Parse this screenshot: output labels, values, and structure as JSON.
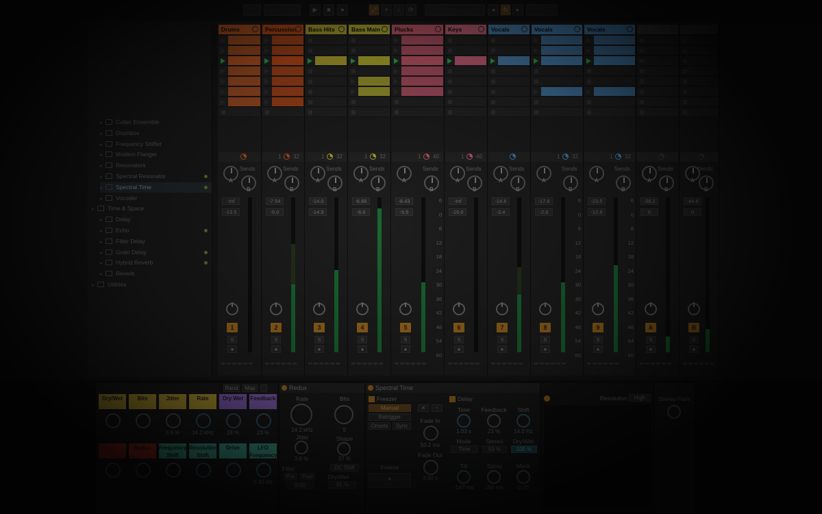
{
  "toolbar": {
    "left_fields": [
      "",
      "",
      ""
    ],
    "right_fields": [
      "",
      "",
      ""
    ]
  },
  "browser": {
    "items": [
      {
        "label": "",
        "indent": 1,
        "folder": false
      },
      {
        "label": "",
        "indent": 1,
        "folder": false
      },
      {
        "label": "",
        "indent": 1,
        "folder": false
      },
      {
        "label": "",
        "indent": 1,
        "folder": false
      },
      {
        "label": "",
        "indent": 1,
        "folder": false
      },
      {
        "label": "Cutter Ensemble",
        "indent": 1,
        "folder": true
      },
      {
        "label": "Drumbox",
        "indent": 1,
        "folder": true
      },
      {
        "label": "Frequency Shifter",
        "indent": 1,
        "folder": true
      },
      {
        "label": "Modern Flanger",
        "indent": 1,
        "folder": true
      },
      {
        "label": "Resonators",
        "indent": 1,
        "folder": true
      },
      {
        "label": "Spectral Resonator",
        "indent": 1,
        "folder": true,
        "dot": true
      },
      {
        "label": "Spectral Time",
        "indent": 1,
        "folder": true,
        "dot": true,
        "selected": true
      },
      {
        "label": "Vocoder",
        "indent": 1,
        "folder": true
      },
      {
        "label": "Time & Space",
        "indent": 0,
        "folder": true
      },
      {
        "label": "Delay",
        "indent": 1,
        "folder": true
      },
      {
        "label": "Echo",
        "indent": 1,
        "folder": true,
        "dot": true
      },
      {
        "label": "Filter Delay",
        "indent": 1,
        "folder": true
      },
      {
        "label": "Grain Delay",
        "indent": 1,
        "folder": true,
        "dot": true
      },
      {
        "label": "Hybrid Reverb",
        "indent": 1,
        "folder": true,
        "dot": true
      },
      {
        "label": "Reverb",
        "indent": 1,
        "folder": true
      },
      {
        "label": "Utilities",
        "indent": 0,
        "folder": true
      }
    ]
  },
  "tracks": [
    {
      "name": "Drums",
      "color": "#e4682a",
      "clips": [
        1,
        1,
        1,
        1,
        1,
        1,
        1
      ],
      "playing": 2,
      "n1": "",
      "n2": "",
      "vol": "-Inf",
      "peak": "-13.5",
      "num": "1",
      "level": 0.0,
      "ghost": 0.0
    },
    {
      "name": "Percussion",
      "color": "#e65a1c",
      "clips": [
        1,
        1,
        1,
        1,
        1,
        1,
        1
      ],
      "playing": 2,
      "n1": "1",
      "n2": "32",
      "vol": "-7.54",
      "peak": "-6.0",
      "num": "2",
      "level": 0.44,
      "ghost": 0.7
    },
    {
      "name": "Bass Hits",
      "color": "#d7c83a",
      "clips": [
        0,
        0,
        1,
        0,
        0,
        0,
        0
      ],
      "playing": 2,
      "n1": "1",
      "n2": "32",
      "vol": "-14.0",
      "peak": "-14.9",
      "num": "3",
      "level": 0.53,
      "ghost": 0.0
    },
    {
      "name": "Bass Main",
      "color": "#dbd43c",
      "clips": [
        0,
        0,
        1,
        0,
        1,
        1,
        0
      ],
      "playing": 2,
      "n1": "1",
      "n2": "32",
      "vol": "-6.66",
      "peak": "-6.0",
      "num": "4",
      "level": 0.93,
      "ghost": 0.0
    },
    {
      "name": "Plucks",
      "color": "#ee6a82",
      "clips": [
        1,
        1,
        1,
        1,
        1,
        1,
        0
      ],
      "playing": 2,
      "n1": "1",
      "n2": "40",
      "vol": "-8.43",
      "peak": "-5.5",
      "num": "5",
      "level": 0.45,
      "ghost": 0.0
    },
    {
      "name": "Keys",
      "color": "#ef7592",
      "clips": [
        0,
        0,
        1,
        0,
        0,
        0,
        0
      ],
      "playing": 2,
      "n1": "1",
      "n2": "40",
      "vol": "-Inf",
      "peak": "-16.0",
      "num": "6",
      "level": 0.0,
      "ghost": 0.0
    },
    {
      "name": "Vocals",
      "color": "#5a9fd8",
      "clips": [
        0,
        0,
        1,
        0,
        0,
        0,
        0
      ],
      "playing": 2,
      "n1": "",
      "n2": "",
      "vol": "-14.6",
      "peak": "-3.4",
      "num": "7",
      "level": 0.37,
      "ghost": 0.55
    },
    {
      "name": "Vocals",
      "color": "#5aa6e6",
      "clips": [
        1,
        1,
        1,
        0,
        0,
        1,
        0
      ],
      "playing": 2,
      "n1": "1",
      "n2": "32",
      "vol": "-17.8",
      "peak": "-2.6",
      "num": "8",
      "level": 0.45,
      "ghost": 0.0
    },
    {
      "name": "Vocals",
      "color": "#56a2e2",
      "clips": [
        1,
        1,
        1,
        0,
        0,
        1,
        0
      ],
      "playing": 2,
      "n1": "1",
      "n2": "32",
      "vol": "-23.5",
      "peak": "-12.8",
      "num": "9",
      "level": 0.56,
      "ghost": 0.0
    },
    {
      "name": "",
      "color": "#4a4a4a",
      "clips": [
        0,
        0,
        0,
        0,
        0,
        0,
        0
      ],
      "playing": -1,
      "n1": "",
      "n2": "",
      "vol": "-38.2",
      "peak": "0",
      "num": "A",
      "level": 0.1,
      "ghost": 0.0
    },
    {
      "name": "",
      "color": "#4a4a4a",
      "clips": [
        0,
        0,
        0,
        0,
        0,
        0,
        0
      ],
      "playing": -1,
      "n1": "",
      "n2": "",
      "vol": "-44.8",
      "peak": "0",
      "num": "B",
      "level": 0.15,
      "ghost": 0.0
    }
  ],
  "mixer": {
    "sends_label": "Sends",
    "knob_a": "A",
    "knob_b": "B",
    "solo": "S",
    "scale": [
      "6",
      "0",
      "6",
      "12",
      "18",
      "24",
      "30",
      "36",
      "42",
      "48",
      "54",
      "60"
    ]
  },
  "macros": {
    "topbtns": [
      "Rand",
      "Map"
    ],
    "row1": [
      {
        "label": "Dry/Wet",
        "color": "#d7b93a",
        "value": ""
      },
      {
        "label": "Bits",
        "color": "#d7b93a",
        "value": ""
      },
      {
        "label": "Jitter",
        "color": "#d7b93a",
        "value": "3.6 %"
      },
      {
        "label": "Rate",
        "color": "#d7b93a",
        "value": "14.2 kHz"
      },
      {
        "label": "Dry Wet",
        "color": "#9a6fd6",
        "value": "28 %"
      },
      {
        "label": "Feedback",
        "color": "#9a6fd6",
        "value": "23 %"
      }
    ],
    "row2": [
      {
        "label": "",
        "color": "#d23a2a",
        "value": ""
      },
      {
        "label": "Redux",
        "color": "#d23a2a",
        "value": ""
      },
      {
        "label": "Frequency Shift",
        "color": "#4bc5a8",
        "value": ""
      },
      {
        "label": "Resolution Shift",
        "color": "#4bc5a8",
        "value": ""
      },
      {
        "label": "Drive",
        "color": "#4bc5a8",
        "value": ""
      },
      {
        "label": "LFO Frequency",
        "color": "#4bc5a8",
        "value": "0.30 Hz"
      }
    ]
  },
  "redux": {
    "title": "Redux",
    "rate_label": "Rate",
    "rate_value": "14.2 kHz",
    "bits_label": "Bits",
    "bits_value": "5",
    "jitter_label": "Jitter",
    "jitter_value": "3.6 %",
    "shape_label": "Shape",
    "shape_value": "37 %",
    "dc_shift": "DC Shift",
    "filter_label": "Filter",
    "pre": "Pre",
    "post": "Post",
    "drywet_label": "Dry/Wet",
    "drywet_value": "81 %",
    "filter_value": "0.00"
  },
  "spectral": {
    "title": "Spectral Time",
    "freezer_label": "Freezer",
    "manual": "Manual",
    "retrigger": "Retrigger",
    "onsets": "Onsets",
    "sync": "Sync",
    "fade_in_label": "Fade In",
    "fade_in_value": "50.2 ms",
    "fade_out_label": "Fade Out",
    "fade_out_value": "3.90 s",
    "freeze_label": "Freeze",
    "freeze_symbol": "*",
    "delay_label": "Delay",
    "time_label": "Time",
    "time_value": "1.03 s",
    "feedback_label": "Feedback",
    "feedback_value": "23 %",
    "shift_label": "Shift",
    "shift_value": "14.0 Hz",
    "mode_label": "Mode",
    "mode_value": "Time",
    "stereo_label": "Stereo",
    "stereo_value": "53 %",
    "drywet_label": "Dry/Wet",
    "drywet_value": "100 %",
    "tilt_label": "Tilt",
    "tilt_value": "-147 ms",
    "spray_label": "Spray",
    "spray_value": "160 ms",
    "mask_label": "Mask",
    "mask_value": "0.00"
  },
  "spectrum": {
    "resolution_label": "Resolution",
    "resolution_value": "High",
    "extra_label": "Stereo Fade"
  }
}
